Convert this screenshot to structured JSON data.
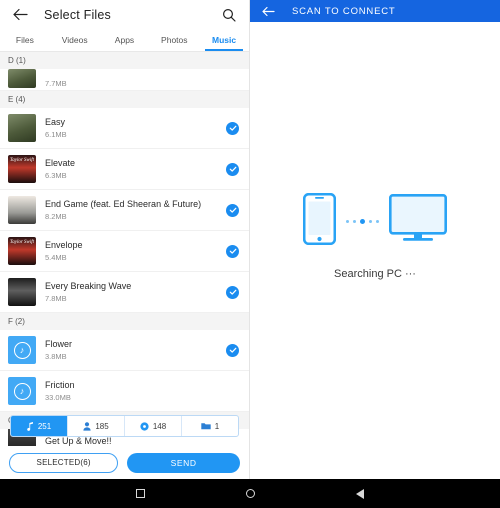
{
  "left": {
    "header": {
      "back_icon": "back-arrow-icon",
      "title": "Select Files",
      "search_icon": "search-icon"
    },
    "tabs": [
      {
        "label": "Files",
        "active": false
      },
      {
        "label": "Videos",
        "active": false
      },
      {
        "label": "Apps",
        "active": false
      },
      {
        "label": "Photos",
        "active": false
      },
      {
        "label": "Music",
        "active": true
      }
    ],
    "sections": [
      {
        "header": "D (1)",
        "items": [
          {
            "title": "",
            "size": "7.7MB",
            "selected": false,
            "art": "art-a",
            "art_text": "",
            "clipped": "top"
          }
        ]
      },
      {
        "header": "E (4)",
        "items": [
          {
            "title": "Easy",
            "size": "6.1MB",
            "selected": true,
            "art": "art-a",
            "art_text": ""
          },
          {
            "title": "Elevate",
            "size": "6.3MB",
            "selected": true,
            "art": "art-b",
            "art_text": "Taylor Swift"
          },
          {
            "title": "End Game (feat. Ed Sheeran & Future)",
            "size": "8.2MB",
            "selected": true,
            "art": "art-c",
            "art_text": ""
          },
          {
            "title": "Envelope",
            "size": "5.4MB",
            "selected": true,
            "art": "art-b",
            "art_text": "Taylor Swift"
          },
          {
            "title": "Every Breaking Wave",
            "size": "7.8MB",
            "selected": true,
            "art": "art-d",
            "art_text": ""
          }
        ]
      },
      {
        "header": "F (2)",
        "items": [
          {
            "title": "Flower",
            "size": "3.8MB",
            "selected": true,
            "art": "music-default",
            "art_text": ""
          },
          {
            "title": "Friction",
            "size": "33.0MB",
            "selected": false,
            "art": "music-default",
            "art_text": ""
          }
        ]
      },
      {
        "header": "G (1)",
        "items": [
          {
            "title": "Get Up & Move!!",
            "size": "",
            "selected": false,
            "art": "art-e",
            "art_text": "",
            "clipped": "bottom"
          }
        ]
      }
    ],
    "counts": [
      {
        "icon": "music-note-icon",
        "value": "251",
        "active": true
      },
      {
        "icon": "contact-person-icon",
        "value": "185",
        "active": false
      },
      {
        "icon": "record-disc-icon",
        "value": "148",
        "active": false
      },
      {
        "icon": "folder-icon",
        "value": "1",
        "active": false
      }
    ],
    "actions": {
      "selected_label": "SELECTED(6)",
      "send_label": "SEND"
    }
  },
  "right": {
    "header": {
      "back_icon": "back-arrow-icon",
      "title": "SCAN TO CONNECT"
    },
    "illustration": {
      "phone_icon": "smartphone-icon",
      "pc_icon": "desktop-monitor-icon",
      "dot_count": 5
    },
    "status_text": "Searching PC ···"
  },
  "navbar": {
    "recent_icon": "recent-apps-icon",
    "home_icon": "home-circle-icon",
    "back_icon": "nav-back-triangle-icon"
  },
  "colors": {
    "accent_blue": "#2196f3",
    "header_blue": "#1565e0",
    "tab_active": "#1a8cf0"
  }
}
